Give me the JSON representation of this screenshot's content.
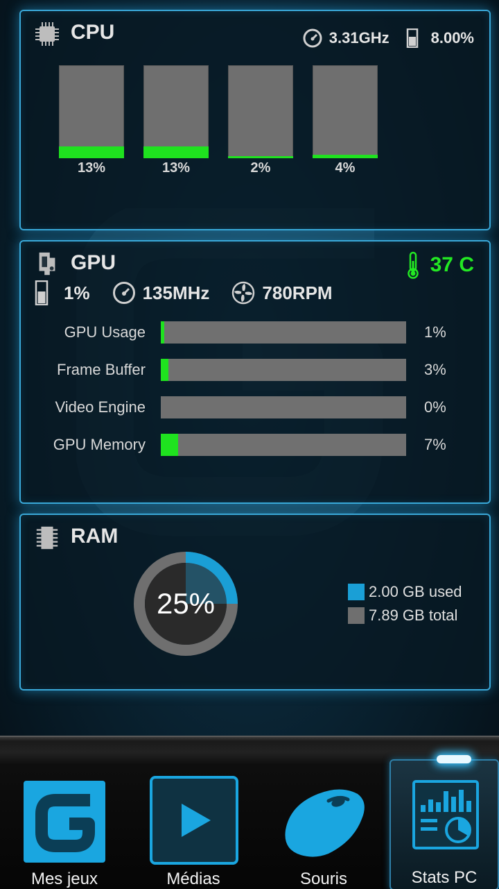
{
  "cpu": {
    "title": "CPU",
    "frequency": "3.31GHz",
    "usage": "8.00%",
    "cores": [
      {
        "label": "13%",
        "value": 13
      },
      {
        "label": "13%",
        "value": 13
      },
      {
        "label": "2%",
        "value": 2
      },
      {
        "label": "4%",
        "value": 4
      }
    ]
  },
  "gpu": {
    "title": "GPU",
    "temperature": "37 C",
    "usage": "1%",
    "clock": "135MHz",
    "fan": "780RPM",
    "metrics": [
      {
        "label": "GPU Usage",
        "value_text": "1%",
        "value": 1
      },
      {
        "label": "Frame Buffer",
        "value_text": "3%",
        "value": 3
      },
      {
        "label": "Video Engine",
        "value_text": "0%",
        "value": 0
      },
      {
        "label": "GPU Memory",
        "value_text": "7%",
        "value": 7
      }
    ]
  },
  "ram": {
    "title": "RAM",
    "percent_text": "25%",
    "percent": 25,
    "used_label": "2.00 GB used",
    "total_label": "7.89 GB total"
  },
  "nav": {
    "items": [
      {
        "label": "Mes jeux",
        "icon": "logitech-g-icon"
      },
      {
        "label": "Médias",
        "icon": "play-icon"
      },
      {
        "label": "Souris",
        "icon": "mouse-icon"
      },
      {
        "label": "Stats PC",
        "icon": "stats-icon",
        "active": true
      }
    ]
  },
  "colors": {
    "accent": "#1a9fd6",
    "bar_fill": "#1fe21f",
    "bar_track": "#707070",
    "temperature": "#23e823"
  }
}
